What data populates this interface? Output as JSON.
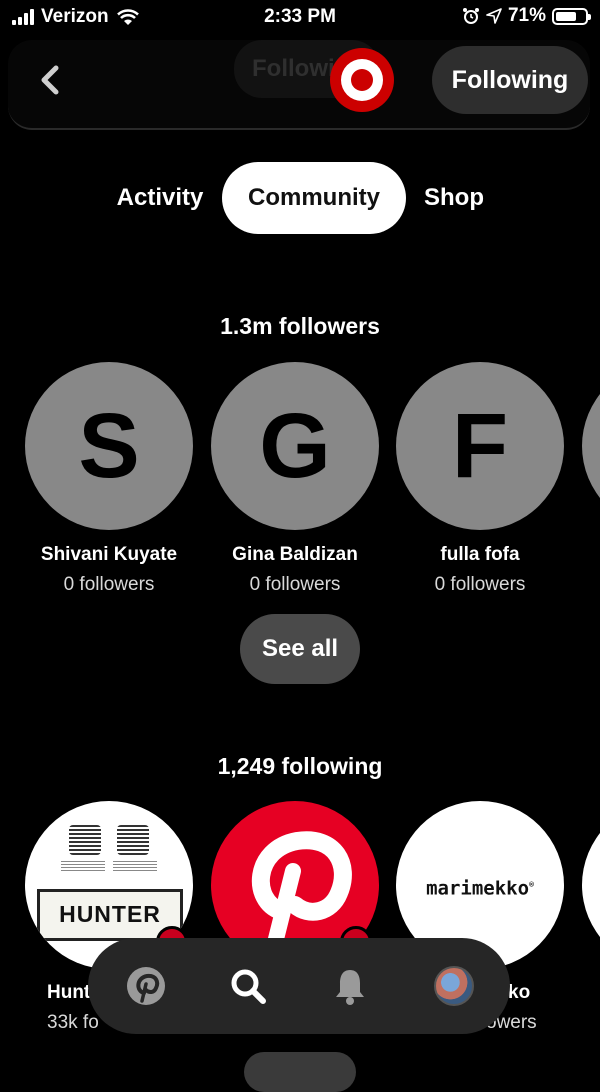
{
  "status_bar": {
    "carrier": "Verizon",
    "time": "2:33 PM",
    "battery_percent": "71%",
    "battery_level": 0.71
  },
  "header": {
    "faded_title": "Following",
    "brand_logo": "target-bullseye-logo",
    "follow_button_label": "Following"
  },
  "tabs": [
    {
      "label": "Activity",
      "active": false
    },
    {
      "label": "Community",
      "active": true
    },
    {
      "label": "Shop",
      "active": false
    }
  ],
  "followers_section": {
    "title": "1.3m followers",
    "people": [
      {
        "initial": "S",
        "name": "Shivani Kuyate",
        "count": "0 followers"
      },
      {
        "initial": "G",
        "name": "Gina Baldizan",
        "count": "0 followers"
      },
      {
        "initial": "F",
        "name": "fulla fofa",
        "count": "0 followers"
      }
    ],
    "see_all_label": "See all"
  },
  "following_section": {
    "title": "1,249 following",
    "accounts": [
      {
        "logo_text": "HUNTER",
        "name": "Hunt",
        "count": "33k fo"
      },
      {
        "logo_icon": "pinterest-p-logo",
        "name": "",
        "count": ""
      },
      {
        "logo_text": "marimekko",
        "name": "ko",
        "count": "owers"
      }
    ]
  },
  "bottom_nav": {
    "items": [
      "pinterest-home-icon",
      "search-icon",
      "notifications-bell-icon",
      "profile-avatar"
    ]
  },
  "colors": {
    "background": "#000000",
    "tab_active_bg": "#ffffff",
    "avatar_gray": "#888888",
    "pinterest_red": "#e60023",
    "target_red": "#cc0000",
    "nav_bg": "#262626"
  }
}
